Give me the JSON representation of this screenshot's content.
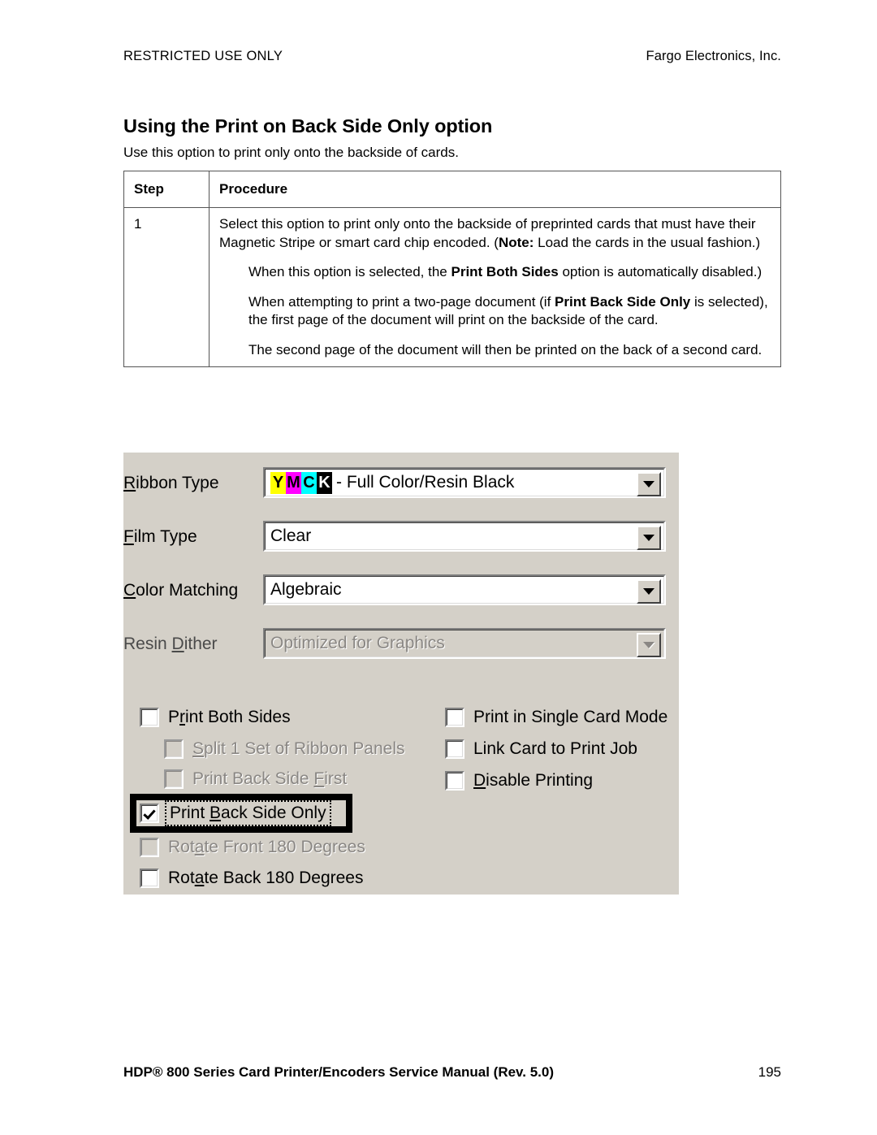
{
  "header": {
    "left": "RESTRICTED USE ONLY",
    "right": "Fargo Electronics, Inc."
  },
  "page_title": "Using the Print on Back Side Only option",
  "intro_text": "Use this option to print only onto the backside of cards.",
  "table": {
    "columns": [
      "Step",
      "Procedure"
    ],
    "rows": [
      {
        "step": "1",
        "paragraphs": [
          {
            "style": "lead",
            "runs": [
              {
                "text": "Select this option to print only onto the backside of preprinted cards that must have their Magnetic Stripe or smart card chip encoded. (",
                "bold": false
              },
              {
                "text": "Note:",
                "bold": true
              },
              {
                "text": "  Load the cards in the usual fashion.)",
                "bold": false
              }
            ]
          },
          {
            "style": "sub",
            "runs": [
              {
                "text": "When this option is selected, the ",
                "bold": false
              },
              {
                "text": "Print Both Sides",
                "bold": true
              },
              {
                "text": " option is automatically disabled.)",
                "bold": false
              }
            ]
          },
          {
            "style": "sub",
            "runs": [
              {
                "text": "When attempting to print a two-page document (if ",
                "bold": false
              },
              {
                "text": "Print Back Side Only",
                "bold": true
              },
              {
                "text": " is selected), the first page of the document will print on the backside of the card.",
                "bold": false
              }
            ]
          },
          {
            "style": "sub",
            "runs": [
              {
                "text": "The second page of the document will then be printed on the back of a second card.",
                "bold": false
              }
            ]
          }
        ]
      }
    ]
  },
  "dialog": {
    "background_color": "#d4d0c8",
    "fields": [
      {
        "label": "Ribbon Type",
        "label_mnemonic": "R",
        "value": "- Full Color/Resin Black",
        "badge": "YMCK",
        "badge_colors": [
          "#ffff00",
          "#ff00ff",
          "#00ffff",
          "#000000"
        ],
        "badge_text_colors": [
          "#000000",
          "#000000",
          "#000000",
          "#ffffff"
        ],
        "disabled": false,
        "arrow_icon": "chevron-down-icon"
      },
      {
        "label": "Film Type",
        "label_mnemonic": "F",
        "value": "Clear",
        "disabled": false,
        "arrow_icon": "chevron-down-icon"
      },
      {
        "label": "Color Matching",
        "label_mnemonic": "C",
        "value": "Algebraic",
        "disabled": false,
        "arrow_icon": "chevron-down-icon"
      },
      {
        "label": "Resin Dither",
        "label_mnemonic": "D",
        "value": "Optimized for Graphics",
        "disabled": true,
        "arrow_icon": "chevron-down-icon"
      }
    ],
    "checkboxes_left": [
      {
        "label": "Print Both Sides",
        "mnemonic": "r",
        "checked": false,
        "disabled": false,
        "indent": false,
        "focused": false,
        "highlighted": false
      },
      {
        "label": "Split 1 Set of Ribbon Panels",
        "mnemonic": "S",
        "checked": false,
        "disabled": true,
        "indent": true,
        "focused": false,
        "highlighted": false
      },
      {
        "label": "Print Back Side First",
        "mnemonic": "F",
        "checked": false,
        "disabled": true,
        "indent": true,
        "focused": false,
        "highlighted": false
      },
      {
        "label": "Print Back Side Only",
        "mnemonic": "B",
        "checked": true,
        "disabled": false,
        "indent": false,
        "focused": true,
        "highlighted": true
      },
      {
        "label": "Rotate Front 180 Degrees",
        "mnemonic": "a",
        "checked": false,
        "disabled": true,
        "indent": false,
        "focused": false,
        "highlighted": false
      },
      {
        "label": "Rotate Back 180 Degrees",
        "mnemonic": "a",
        "checked": false,
        "disabled": false,
        "indent": false,
        "focused": false,
        "highlighted": false
      }
    ],
    "checkboxes_right": [
      {
        "label": "Print in Single Card Mode",
        "checked": false,
        "disabled": false
      },
      {
        "label": "Link Card to Print Job",
        "checked": false,
        "disabled": false
      },
      {
        "label": "Disable Printing",
        "mnemonic": "D",
        "checked": false,
        "disabled": false
      }
    ]
  },
  "footer": {
    "left": "HDP® 800 Series Card Printer/Encoders Service Manual (Rev. 5.0)",
    "right": "195"
  }
}
